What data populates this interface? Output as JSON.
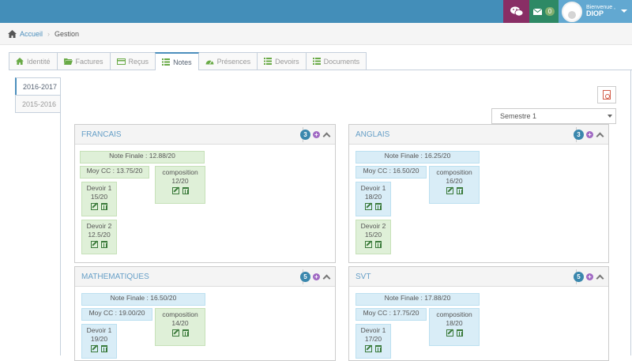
{
  "topbar": {
    "mail_count": "0",
    "user_greeting": "Bienvenue ,",
    "user_name": "DIOP",
    "chat_icon": "wechat-icon",
    "mail_icon": "envelope-icon",
    "color": "#438eb9"
  },
  "breadcrumb": {
    "home_icon": "home-icon",
    "home": "Accueil",
    "current": "Gestion"
  },
  "tabs": [
    {
      "label": "Identité",
      "icon": "home-icon",
      "icon_color": "#69aa46"
    },
    {
      "label": "Factures",
      "icon": "folder-open-icon",
      "icon_color": "#69aa46"
    },
    {
      "label": "Reçus",
      "icon": "credit-card-icon",
      "icon_color": "#69aa46"
    },
    {
      "label": "Notes",
      "icon": "list-icon",
      "icon_color": "#69aa46"
    },
    {
      "label": "Présences",
      "icon": "tachometer-icon",
      "icon_color": "#69aa46"
    },
    {
      "label": "Devoirs",
      "icon": "list-icon",
      "icon_color": "#69aa46"
    },
    {
      "label": "Documents",
      "icon": "list-icon",
      "icon_color": "#69aa46"
    }
  ],
  "years": [
    "2016-2017",
    "2015-2016"
  ],
  "pdf_icon": "file-pdf-icon",
  "semester": "Semestre 1",
  "subjects": [
    {
      "title": "FRANCAIS",
      "count": "3",
      "color": "green",
      "note_finale": "Note Finale : 12.88/20",
      "moy_cc": "Moy CC : 13.75/20",
      "composition": {
        "label": "composition",
        "grade": "12/20"
      },
      "devoirs": [
        {
          "label": "Devoir 1",
          "grade": "15/20"
        },
        {
          "label": "Devoir 2",
          "grade": "12.5/20"
        }
      ]
    },
    {
      "title": "ANGLAIS",
      "count": "3",
      "color": "blue",
      "note_finale": "Note Finale : 16.25/20",
      "moy_cc": "Moy CC : 16.50/20",
      "composition": {
        "label": "composition",
        "grade": "16/20"
      },
      "devoirs": [
        {
          "label": "Devoir 1",
          "grade": "18/20"
        },
        {
          "label": "Devoir 2",
          "grade": "15/20"
        }
      ]
    },
    {
      "title": "MATHEMATIQUES",
      "count": "5",
      "color": "mixed",
      "note_finale": "Note Finale : 16.50/20",
      "moy_cc": "Moy CC : 19.00/20",
      "composition": {
        "label": "composition",
        "grade": "14/20"
      },
      "devoirs": [
        {
          "label": "Devoir 1",
          "grade": "19/20"
        }
      ]
    },
    {
      "title": "SVT",
      "count": "5",
      "color": "blue",
      "note_finale": "Note Finale : 17.88/20",
      "moy_cc": "Moy CC : 17.75/20",
      "composition": {
        "label": "composition",
        "grade": "18/20"
      },
      "devoirs": [
        {
          "label": "Devoir 1",
          "grade": "17/20"
        }
      ]
    }
  ]
}
